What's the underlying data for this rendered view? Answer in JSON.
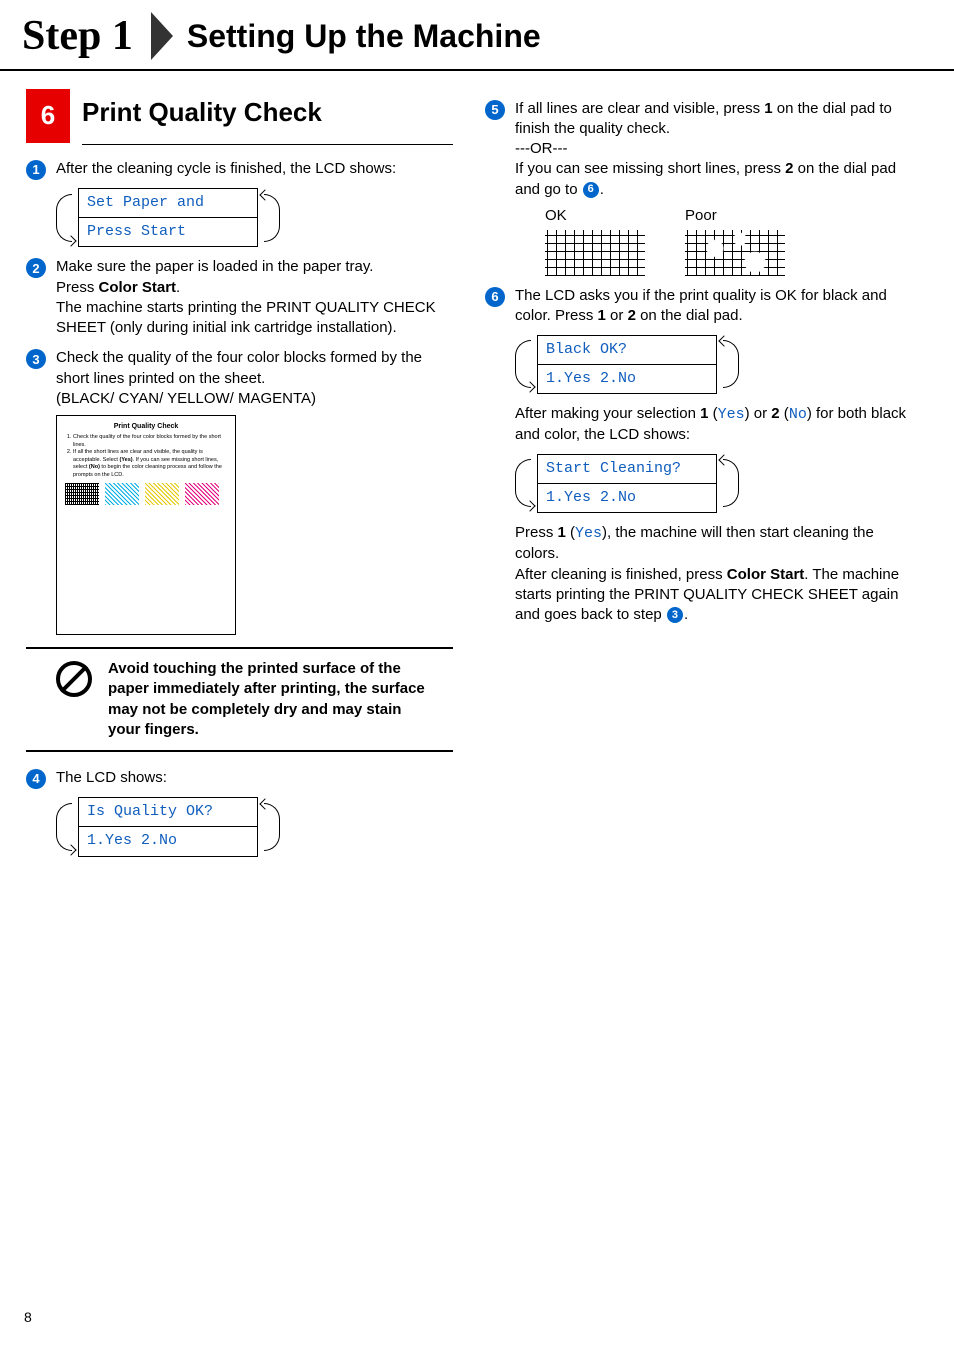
{
  "header": {
    "step_label": "Step 1",
    "title": "Setting Up the Machine"
  },
  "section": {
    "number": "6",
    "title": "Print Quality Check"
  },
  "left": {
    "s1": "After the cleaning cycle is finished, the LCD shows:",
    "lcd1_line1": "Set Paper and",
    "lcd1_line2": "Press Start",
    "s2a": "Make sure the paper is loaded in the paper tray.",
    "s2b_pre": "Press ",
    "s2b_bold": "Color Start",
    "s2b_post": ".",
    "s2c": "The machine starts printing the PRINT QUALITY CHECK SHEET (only during initial ink cartridge installation).",
    "s3a": "Check the quality of the four color blocks formed by the short lines printed on the sheet.",
    "s3b": "(BLACK/ CYAN/ YELLOW/ MAGENTA)",
    "sheet_title": "Print Quality Check",
    "sheet_item1": "Check the quality of the four color blocks formed by the short lines.",
    "sheet_item2_a": "If all the short lines are clear and visible, the quality is acceptable. Select ",
    "sheet_item2_yes": "(Yes)",
    "sheet_item2_b": ". If you can see missing short lines, select ",
    "sheet_item2_no": "(No)",
    "sheet_item2_c": " to begin the color cleaning process and follow the prompts on the LCD.",
    "caution": "Avoid touching the printed surface of the paper immediately after printing, the surface may not be completely dry and may stain your fingers.",
    "s4": "The LCD shows:",
    "lcd4_line1": "Is Quality OK?",
    "lcd4_line2": "1.Yes 2.No"
  },
  "right": {
    "s5a_pre": "If all lines are clear and visible, press ",
    "s5a_bold": "1",
    "s5a_post": " on the dial pad to finish the quality check.",
    "s5b": "---OR---",
    "s5c_pre": "If you can see missing short lines, press ",
    "s5c_bold": "2",
    "s5c_post": " on the dial pad and go to ",
    "s5c_ref": "6",
    "s5c_end": ".",
    "ok_label": "OK",
    "poor_label": "Poor",
    "s6a_pre": "The LCD asks you if the print quality is OK for black and color. Press ",
    "s6a_b1": "1",
    "s6a_mid": " or ",
    "s6a_b2": "2",
    "s6a_post": " on the dial pad.",
    "lcd6a_line1": "Black OK?",
    "lcd6a_line2": "1.Yes 2.No",
    "s6b_pre": "After making your selection ",
    "s6b_b1": "1",
    "s6b_p1": " (",
    "s6b_yes": "Yes",
    "s6b_p2": ") or ",
    "s6b_b2": "2",
    "s6b_p3": " (",
    "s6b_no": "No",
    "s6b_p4": ") for both black and color, the LCD shows:",
    "lcd6b_line1": "Start Cleaning?",
    "lcd6b_line2": "1.Yes 2.No",
    "s6c_pre": "Press ",
    "s6c_b": "1",
    "s6c_p1": " (",
    "s6c_yes": "Yes",
    "s6c_p2": "), the machine will then start cleaning the colors.",
    "s6d_pre": "After cleaning is finished, press ",
    "s6d_bold": "Color Start",
    "s6d_post": ". The machine starts printing the PRINT QUALITY CHECK SHEET again and goes back to step ",
    "s6d_ref": "3",
    "s6d_end": "."
  },
  "page_number": "8"
}
